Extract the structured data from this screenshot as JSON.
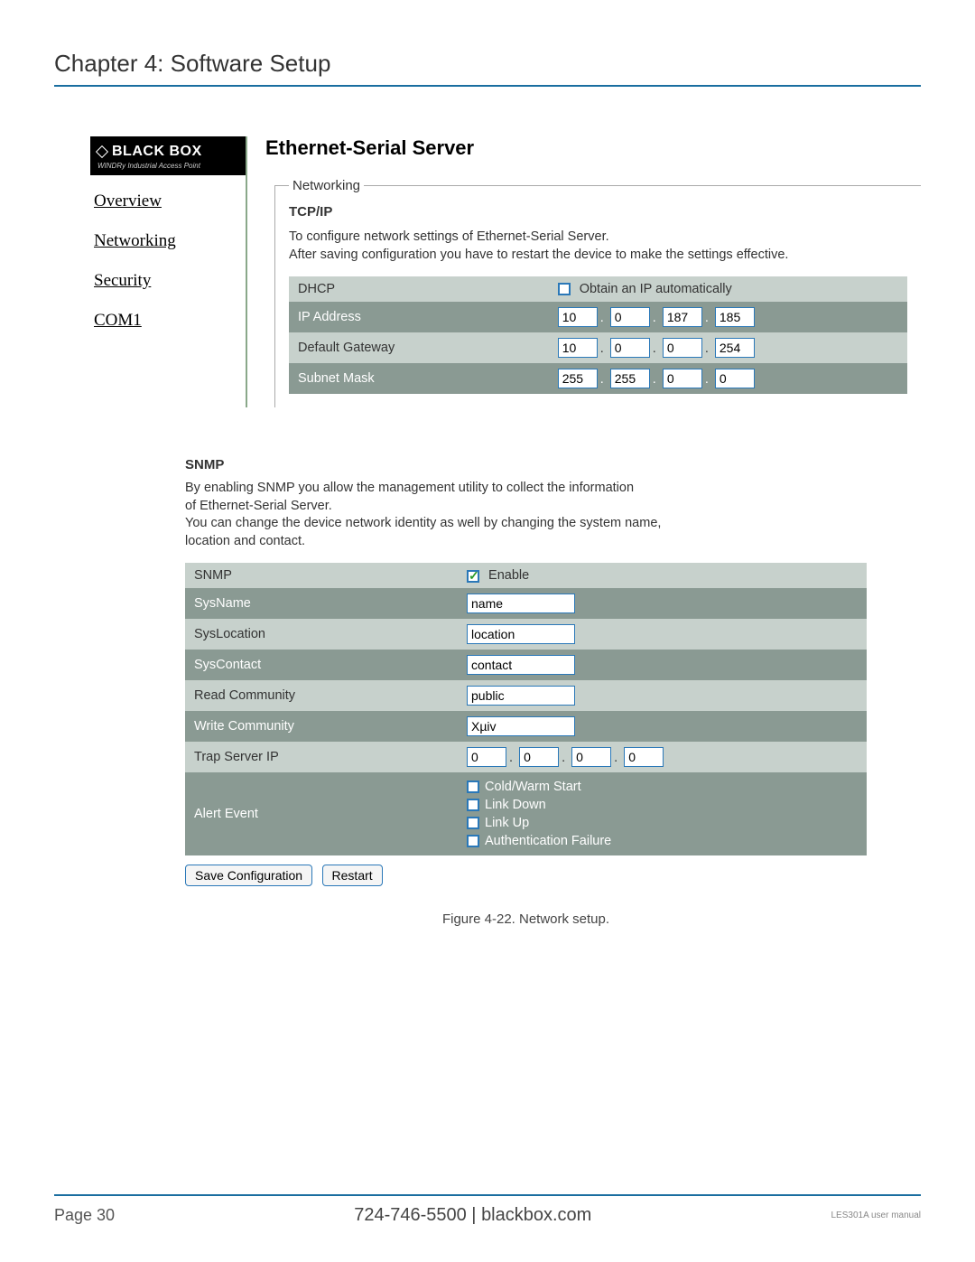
{
  "chapter_title": "Chapter 4: Software Setup",
  "logo": {
    "brand": "BLACK BOX",
    "subtitle": "WINDRy Industrial Access Point"
  },
  "nav": {
    "overview": "Overview",
    "networking": "Networking",
    "security": "Security",
    "com1": "COM1"
  },
  "server_title": "Ethernet-Serial Server",
  "fieldset_legend": "Networking",
  "tcpip": {
    "label": "TCP/IP",
    "desc_line1": "To configure network settings of Ethernet-Serial Server.",
    "desc_line2": "After saving configuration you have to restart the device to make the settings effective.",
    "rows": {
      "dhcp": {
        "label": "DHCP",
        "option": "Obtain an IP automatically",
        "checked": false
      },
      "ip": {
        "label": "IP Address",
        "o1": "10",
        "o2": "0",
        "o3": "187",
        "o4": "185"
      },
      "gw": {
        "label": "Default Gateway",
        "o1": "10",
        "o2": "0",
        "o3": "0",
        "o4": "254"
      },
      "mask": {
        "label": "Subnet Mask",
        "o1": "255",
        "o2": "255",
        "o3": "0",
        "o4": "0"
      }
    }
  },
  "snmp": {
    "label": "SNMP",
    "desc_line1": "By enabling SNMP you allow the management utility to collect the information",
    "desc_line2": "of Ethernet-Serial Server.",
    "desc_line3": "You can change the device network identity as well by changing the system name,",
    "desc_line4": "location and contact.",
    "rows": {
      "enable": {
        "label": "SNMP",
        "option": "Enable",
        "checked": true
      },
      "sysname": {
        "label": "SysName",
        "value": "name"
      },
      "syslocation": {
        "label": "SysLocation",
        "value": "location"
      },
      "syscontact": {
        "label": "SysContact",
        "value": "contact"
      },
      "readcomm": {
        "label": "Read Community",
        "value": "public"
      },
      "writecomm": {
        "label": "Write Community",
        "value": "Xµiv"
      },
      "trapip": {
        "label": "Trap Server IP",
        "o1": "0",
        "o2": "0",
        "o3": "0",
        "o4": "0"
      },
      "alert": {
        "label": "Alert Event",
        "events": {
          "coldwarm": {
            "text": "Cold/Warm Start",
            "checked": false
          },
          "linkdown": {
            "text": "Link Down",
            "checked": false
          },
          "linkup": {
            "text": "Link Up",
            "checked": false
          },
          "authfail": {
            "text": "Authentication Failure",
            "checked": false
          }
        }
      }
    }
  },
  "buttons": {
    "save": "Save Configuration",
    "restart": "Restart"
  },
  "caption": "Figure 4-22. Network setup.",
  "footer": {
    "page": "Page 30",
    "center": "724-746-5500   |   blackbox.com",
    "manual": "LES301A user manual"
  }
}
